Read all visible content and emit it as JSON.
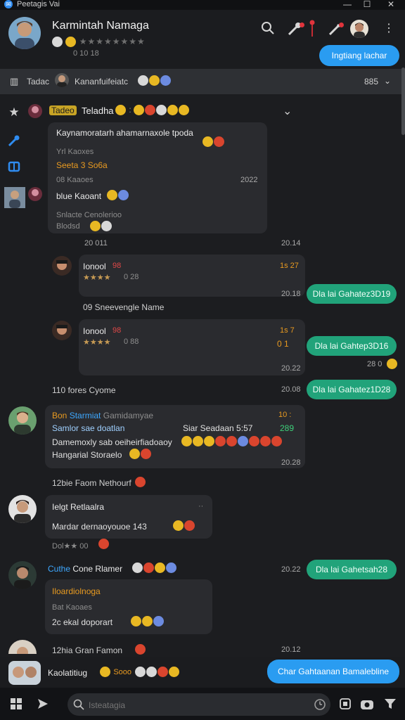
{
  "window": {
    "title": "Peetagis  Vai",
    "buttons": [
      "—",
      "☐",
      "✕"
    ]
  },
  "header": {
    "name": "Karmintah Namaga",
    "stars": "★★★★★★★★",
    "status": "0  10   18",
    "action_button": "Ingtiang  lachar"
  },
  "subbar": {
    "left_label": "Tadac",
    "center_label": "Kananfuifeiatc",
    "right_label": "885"
  },
  "thread": {
    "group_title": "Tadeo",
    "group_name": "Teladha"
  },
  "messages": {
    "top_bubble": {
      "title": "Kaynamoratarh ahamarnaxole tpoda",
      "line2": "Yrl Kaoxes",
      "line3": "Seeta  3  So6a",
      "line4": "08  Kaaoes",
      "time": "2022",
      "name2": "blue  Kaoant",
      "sub1": "Snlacte  Cenolerioo",
      "sub2": "Blodsd"
    },
    "time_row_1": {
      "left": "20  011",
      "right": "20.14"
    },
    "reply_1": {
      "name": "Ionool",
      "meta": "98",
      "stars": "★★★★",
      "rating": "0 28",
      "right_tag": "1s 27",
      "time": "20.18"
    },
    "green_1": "Dla lai  Gahatez3D19",
    "caption_1": "09  Sneevengle  Name",
    "reply_2": {
      "name": "Ionool",
      "meta": "98",
      "stars": "★★★★",
      "rating": "0 88",
      "right_tag": "1s 7",
      "time": "20.22",
      "code": "0 1"
    },
    "green_2": "Dla lai  Gahtep3D16",
    "green_2_time": "28 0",
    "section_1": {
      "label": "110  fores  Cyome",
      "time": "20.08"
    },
    "green_3": "Dla lai  Gahatez1D28",
    "rich_msg": {
      "line1a": "Bon",
      "line1b": "Starmiat",
      "line1c": "Gamidamyae",
      "line1r": "10  :",
      "line2": "Samlor  sae  doatlan",
      "line2r": "Siar  Seadaan   5:57",
      "line2n": "289",
      "line3": "Damemoxly  sab  oeiheirfiadoaoy",
      "line4": "Hangarial  Storaelo",
      "time": "20.28"
    },
    "section_2": {
      "label": "12bie  Faom  Nethourf"
    },
    "reply_3": {
      "name": "Ielgt  Retlaalra",
      "body": "Mardar  dernaoyouoe  143",
      "foot": "Dol★★ 00"
    },
    "reply_4": {
      "name": "Cuthe",
      "name2": "Cone  Rlamer",
      "time": "20.22",
      "sub1": "Iloardiolnoga",
      "sub2": "Bat  Kaoaes",
      "sub3": "2c  ekal  doporart"
    },
    "green_4": "Dla lai  Gahetsah28",
    "section_3": {
      "label": "12hia  Gran  Famon",
      "time": "20.12"
    }
  },
  "footer_contact": {
    "name": "Kaolatitiug",
    "tag": "Sooo",
    "button": "Char  Gahtaanan  Bamalebline"
  },
  "bottombar": {
    "search_placeholder": "Isteatagia"
  },
  "colors": {
    "accent_blue": "#2a9cf1",
    "bubble_green": "#21a37a",
    "background": "#1c1d20",
    "alert_red": "#e0343c"
  },
  "icons": [
    "app-icon",
    "search-icon",
    "mic-icon",
    "star-icon",
    "pencil-icon",
    "bookmark-icon",
    "kebab-icon",
    "chevron-down-icon",
    "grid-icon",
    "send-icon",
    "clock-icon",
    "square-icon",
    "camera-icon",
    "filter-icon"
  ]
}
